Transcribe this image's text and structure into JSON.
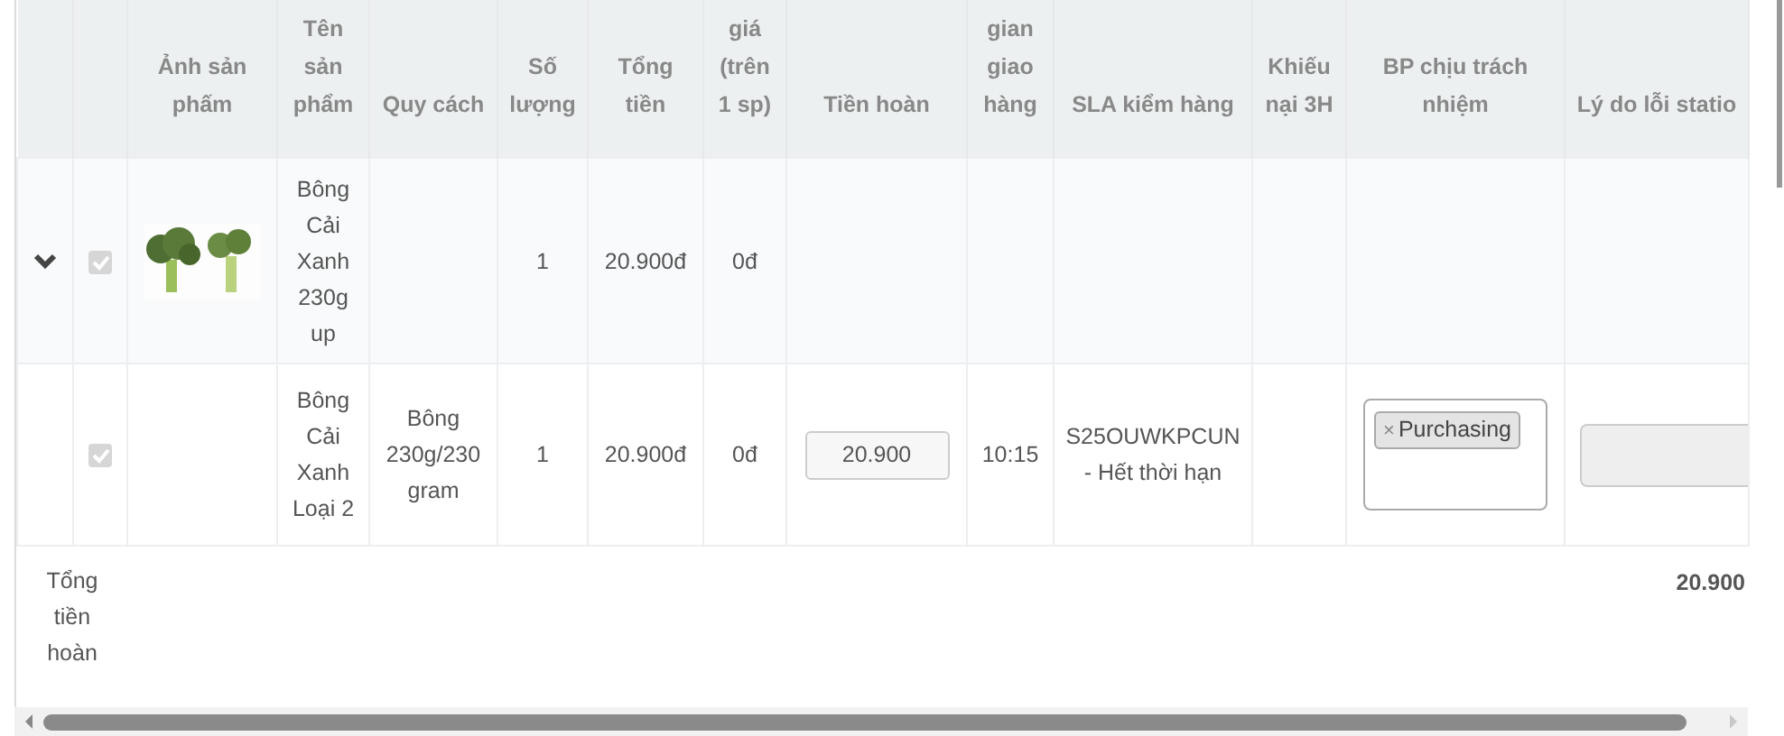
{
  "table": {
    "columns": [
      "",
      "",
      "Ảnh sản phấm",
      "Tên sản phẩm",
      "Quy cách",
      "Số lượng",
      "Tổng tiền",
      "giá (trên 1 sp)",
      "Tiền hoàn",
      "gian giao hàng",
      "SLA kiểm hàng",
      "Khiếu nại 3H",
      "BP chịu trách nhiệm",
      "Lý do lỗi statio"
    ],
    "rows": [
      {
        "kind": "parent",
        "expanded": true,
        "checked": true,
        "disabled": true,
        "has_image": true,
        "name": "Bông Cải Xanh 230g up",
        "quantity": "1",
        "total": "20.900đ",
        "unit_value": "0đ"
      },
      {
        "kind": "child",
        "checked": true,
        "disabled": true,
        "name": "Bông Cải Xanh Loại 2",
        "spec": "Bông 230g/230 gram",
        "quantity": "1",
        "total": "20.900đ",
        "unit_value": "0đ",
        "refund": "20.900",
        "delivery_time": "10:15",
        "sla": "S25OUWKPCUN - Hết thời hạn",
        "departments": [
          {
            "remove": "×",
            "label": "Purchasing"
          }
        ],
        "reason_disabled": true
      }
    ],
    "footer": {
      "label": "Tổng tiền hoàn",
      "amount": "20.900"
    }
  }
}
